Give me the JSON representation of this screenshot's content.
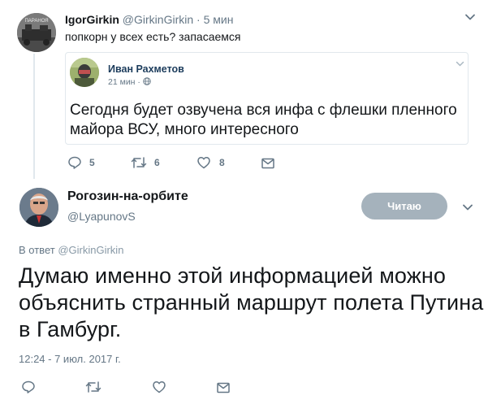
{
  "tweet1": {
    "name": "IgorGirkin",
    "handle": "@GirkinGirkin",
    "separator": "·",
    "time": "5 мин",
    "text": "попкорн у всех есть? запасаемся",
    "avatar_caption": "ПАРАНОЯ",
    "quote": {
      "name": "Иван Рахметов",
      "time": "21 мин ·",
      "text": "Сегодня будет озвучена вся инфа с флешки пленного майора ВСУ, много интересного"
    },
    "actions": {
      "reply_count": "5",
      "retweet_count": "6",
      "like_count": "8"
    }
  },
  "tweet2": {
    "name": "Рогозин-на-орбите",
    "handle": "@LyapunovS",
    "follow_label": "Читаю",
    "reply_to_prefix": "В ответ",
    "reply_to_handle": "@GirkinGirkin",
    "text": "Думаю именно этой информацией можно объяснить странный маршрут полета Путина в Гамбург.",
    "date": "12:24 - 7 июл. 2017 г."
  },
  "colors": {
    "secondary_text": "#657786",
    "border": "#e1e8ed",
    "follow_button": "#a5b2bc",
    "icon": "#657786"
  },
  "icons": [
    "chevron-down-icon",
    "globe-icon",
    "reply-icon",
    "retweet-icon",
    "heart-icon",
    "envelope-icon"
  ]
}
